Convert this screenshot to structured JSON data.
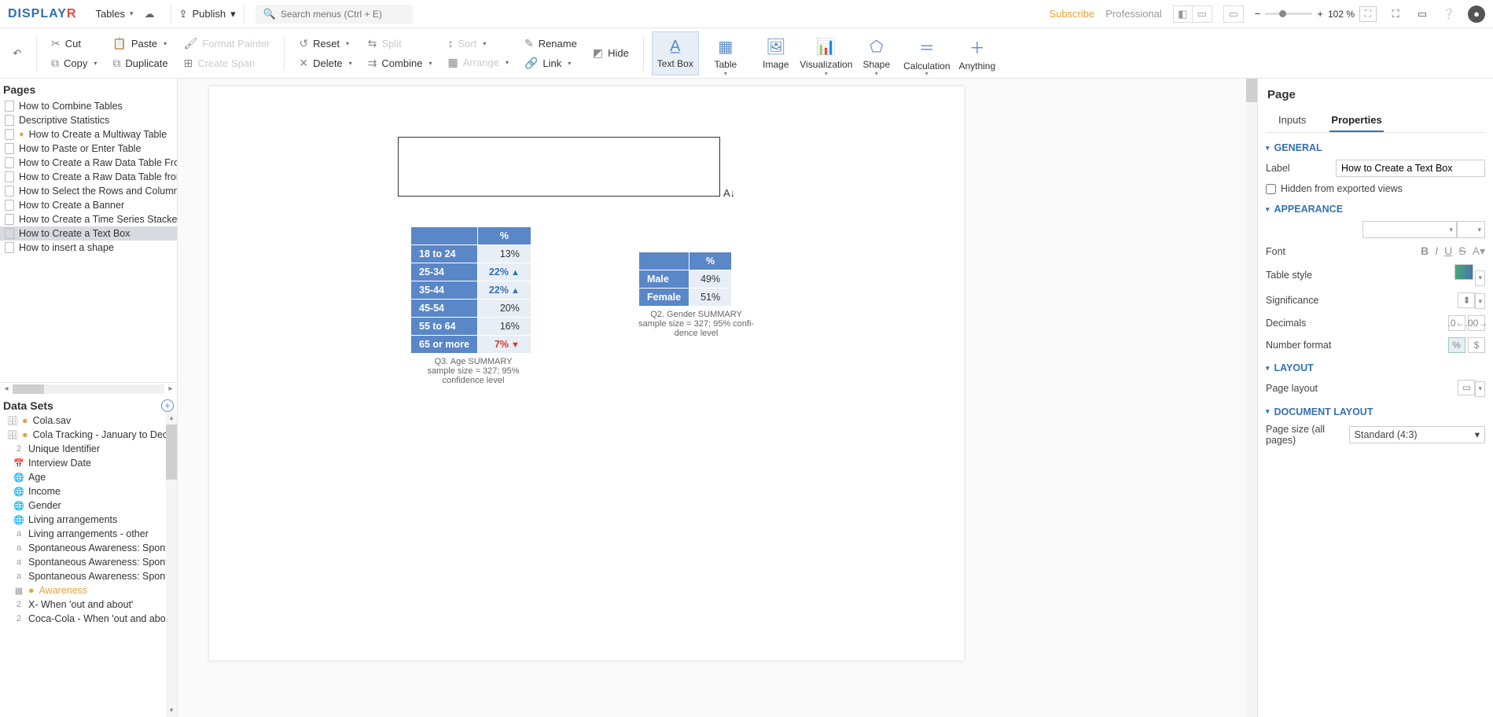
{
  "topbar": {
    "logo_main": "DISPLAY",
    "logo_accent": "R",
    "menu_tables": "Tables",
    "publish": "Publish",
    "search_placeholder": "Search menus (Ctrl + E)",
    "subscribe": "Subscribe",
    "plan": "Professional",
    "zoom": "102 %"
  },
  "ribbon": {
    "cut": "Cut",
    "copy": "Copy",
    "paste": "Paste",
    "duplicate": "Duplicate",
    "format_painter": "Format Painter",
    "create_span": "Create Span",
    "reset": "Reset",
    "delete": "Delete",
    "split": "Split",
    "combine": "Combine",
    "sort": "Sort",
    "arrange": "Arrange",
    "rename": "Rename",
    "hide": "Hide",
    "link": "Link",
    "text_box": "Text Box",
    "table": "Table",
    "image": "Image",
    "visualization": "Visualization",
    "shape": "Shape",
    "calculation": "Calculation",
    "anything": "Anything"
  },
  "pages": {
    "header": "Pages",
    "items": [
      {
        "label": "How to Combine Tables"
      },
      {
        "label": "Descriptive Statistics"
      },
      {
        "label": "How to Create a Multiway Table",
        "warn": true
      },
      {
        "label": "How to Paste or Enter Table"
      },
      {
        "label": "How to Create a Raw Data Table From a V"
      },
      {
        "label": "How to Create a Raw Data Table from Var"
      },
      {
        "label": "How to Select the Rows and Columns to A"
      },
      {
        "label": "How to Create a Banner"
      },
      {
        "label": "How to Create a Time Series Stacked by Y"
      },
      {
        "label": "How to Create a Text Box",
        "selected": true
      },
      {
        "label": "How to insert a shape"
      }
    ]
  },
  "datasets": {
    "header": "Data Sets",
    "items": [
      {
        "label": "Cola.sav",
        "ico": "db",
        "root": true,
        "warn": true
      },
      {
        "label": "Cola Tracking - January to December",
        "ico": "db",
        "root": true,
        "warn": true
      },
      {
        "label": "Unique Identifier",
        "ico": "2"
      },
      {
        "label": "Interview Date",
        "ico": "cal"
      },
      {
        "label": "Age",
        "ico": "globe"
      },
      {
        "label": "Income",
        "ico": "globe"
      },
      {
        "label": "Gender",
        "ico": "globe"
      },
      {
        "label": "Living arrangements",
        "ico": "globe"
      },
      {
        "label": "Living arrangements - other",
        "ico": "a"
      },
      {
        "label": "Spontaneous Awareness: Spontaneou",
        "ico": "a"
      },
      {
        "label": "Spontaneous Awareness: Spontaneou",
        "ico": "a"
      },
      {
        "label": "Spontaneous Awareness: Spontaneou",
        "ico": "a"
      },
      {
        "label": "Awareness",
        "ico": "grid",
        "warn_text": true,
        "warn": true
      },
      {
        "label": "X- When 'out and about'",
        "ico": "2"
      },
      {
        "label": "Coca-Cola - When 'out and about'",
        "ico": "2"
      }
    ]
  },
  "canvas": {
    "cursor_ind": "A↓",
    "age_table": {
      "header": "%",
      "rows": [
        {
          "cat": "18 to 24",
          "val": "13%",
          "dir": ""
        },
        {
          "cat": "25-34",
          "val": "22%",
          "dir": "up"
        },
        {
          "cat": "35-44",
          "val": "22%",
          "dir": "up"
        },
        {
          "cat": "45-54",
          "val": "20%",
          "dir": ""
        },
        {
          "cat": "55 to 64",
          "val": "16%",
          "dir": ""
        },
        {
          "cat": "65 or more",
          "val": "7%",
          "dir": "down"
        }
      ],
      "caption1": "Q3. Age SUMMARY",
      "caption2": "sample size = 327; 95% confidence level"
    },
    "gender_table": {
      "header": "%",
      "rows": [
        {
          "cat": "Male",
          "val": "49%"
        },
        {
          "cat": "Female",
          "val": "51%"
        }
      ],
      "caption1": "Q2. Gender SUMMARY",
      "caption2": "sample size = 327; 95% confi-\ndence level"
    }
  },
  "right": {
    "title": "Page",
    "tab_inputs": "Inputs",
    "tab_properties": "Properties",
    "sec_general": "GENERAL",
    "label": "Label",
    "label_value": "How to Create a Text Box",
    "hidden": "Hidden from exported views",
    "sec_appearance": "APPEARANCE",
    "font": "Font",
    "table_style": "Table style",
    "significance": "Significance",
    "decimals": "Decimals",
    "number_format": "Number format",
    "percent": "%",
    "dollar": "$",
    "sec_layout": "LAYOUT",
    "page_layout": "Page layout",
    "sec_doc_layout": "DOCUMENT LAYOUT",
    "page_size": "Page size (all pages)",
    "page_size_value": "Standard (4:3)"
  }
}
